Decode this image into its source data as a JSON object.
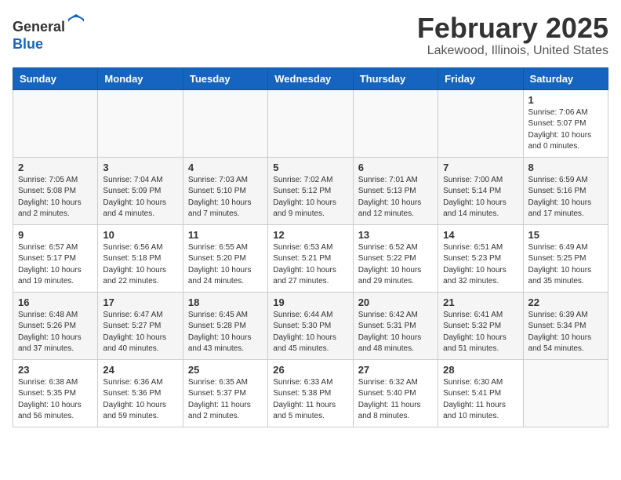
{
  "header": {
    "logo_line1": "General",
    "logo_line2": "Blue",
    "month": "February 2025",
    "location": "Lakewood, Illinois, United States"
  },
  "weekdays": [
    "Sunday",
    "Monday",
    "Tuesday",
    "Wednesday",
    "Thursday",
    "Friday",
    "Saturday"
  ],
  "weeks": [
    [
      {
        "day": "",
        "info": ""
      },
      {
        "day": "",
        "info": ""
      },
      {
        "day": "",
        "info": ""
      },
      {
        "day": "",
        "info": ""
      },
      {
        "day": "",
        "info": ""
      },
      {
        "day": "",
        "info": ""
      },
      {
        "day": "1",
        "info": "Sunrise: 7:06 AM\nSunset: 5:07 PM\nDaylight: 10 hours\nand 0 minutes."
      }
    ],
    [
      {
        "day": "2",
        "info": "Sunrise: 7:05 AM\nSunset: 5:08 PM\nDaylight: 10 hours\nand 2 minutes."
      },
      {
        "day": "3",
        "info": "Sunrise: 7:04 AM\nSunset: 5:09 PM\nDaylight: 10 hours\nand 4 minutes."
      },
      {
        "day": "4",
        "info": "Sunrise: 7:03 AM\nSunset: 5:10 PM\nDaylight: 10 hours\nand 7 minutes."
      },
      {
        "day": "5",
        "info": "Sunrise: 7:02 AM\nSunset: 5:12 PM\nDaylight: 10 hours\nand 9 minutes."
      },
      {
        "day": "6",
        "info": "Sunrise: 7:01 AM\nSunset: 5:13 PM\nDaylight: 10 hours\nand 12 minutes."
      },
      {
        "day": "7",
        "info": "Sunrise: 7:00 AM\nSunset: 5:14 PM\nDaylight: 10 hours\nand 14 minutes."
      },
      {
        "day": "8",
        "info": "Sunrise: 6:59 AM\nSunset: 5:16 PM\nDaylight: 10 hours\nand 17 minutes."
      }
    ],
    [
      {
        "day": "9",
        "info": "Sunrise: 6:57 AM\nSunset: 5:17 PM\nDaylight: 10 hours\nand 19 minutes."
      },
      {
        "day": "10",
        "info": "Sunrise: 6:56 AM\nSunset: 5:18 PM\nDaylight: 10 hours\nand 22 minutes."
      },
      {
        "day": "11",
        "info": "Sunrise: 6:55 AM\nSunset: 5:20 PM\nDaylight: 10 hours\nand 24 minutes."
      },
      {
        "day": "12",
        "info": "Sunrise: 6:53 AM\nSunset: 5:21 PM\nDaylight: 10 hours\nand 27 minutes."
      },
      {
        "day": "13",
        "info": "Sunrise: 6:52 AM\nSunset: 5:22 PM\nDaylight: 10 hours\nand 29 minutes."
      },
      {
        "day": "14",
        "info": "Sunrise: 6:51 AM\nSunset: 5:23 PM\nDaylight: 10 hours\nand 32 minutes."
      },
      {
        "day": "15",
        "info": "Sunrise: 6:49 AM\nSunset: 5:25 PM\nDaylight: 10 hours\nand 35 minutes."
      }
    ],
    [
      {
        "day": "16",
        "info": "Sunrise: 6:48 AM\nSunset: 5:26 PM\nDaylight: 10 hours\nand 37 minutes."
      },
      {
        "day": "17",
        "info": "Sunrise: 6:47 AM\nSunset: 5:27 PM\nDaylight: 10 hours\nand 40 minutes."
      },
      {
        "day": "18",
        "info": "Sunrise: 6:45 AM\nSunset: 5:28 PM\nDaylight: 10 hours\nand 43 minutes."
      },
      {
        "day": "19",
        "info": "Sunrise: 6:44 AM\nSunset: 5:30 PM\nDaylight: 10 hours\nand 45 minutes."
      },
      {
        "day": "20",
        "info": "Sunrise: 6:42 AM\nSunset: 5:31 PM\nDaylight: 10 hours\nand 48 minutes."
      },
      {
        "day": "21",
        "info": "Sunrise: 6:41 AM\nSunset: 5:32 PM\nDaylight: 10 hours\nand 51 minutes."
      },
      {
        "day": "22",
        "info": "Sunrise: 6:39 AM\nSunset: 5:34 PM\nDaylight: 10 hours\nand 54 minutes."
      }
    ],
    [
      {
        "day": "23",
        "info": "Sunrise: 6:38 AM\nSunset: 5:35 PM\nDaylight: 10 hours\nand 56 minutes."
      },
      {
        "day": "24",
        "info": "Sunrise: 6:36 AM\nSunset: 5:36 PM\nDaylight: 10 hours\nand 59 minutes."
      },
      {
        "day": "25",
        "info": "Sunrise: 6:35 AM\nSunset: 5:37 PM\nDaylight: 11 hours\nand 2 minutes."
      },
      {
        "day": "26",
        "info": "Sunrise: 6:33 AM\nSunset: 5:38 PM\nDaylight: 11 hours\nand 5 minutes."
      },
      {
        "day": "27",
        "info": "Sunrise: 6:32 AM\nSunset: 5:40 PM\nDaylight: 11 hours\nand 8 minutes."
      },
      {
        "day": "28",
        "info": "Sunrise: 6:30 AM\nSunset: 5:41 PM\nDaylight: 11 hours\nand 10 minutes."
      },
      {
        "day": "",
        "info": ""
      }
    ]
  ]
}
